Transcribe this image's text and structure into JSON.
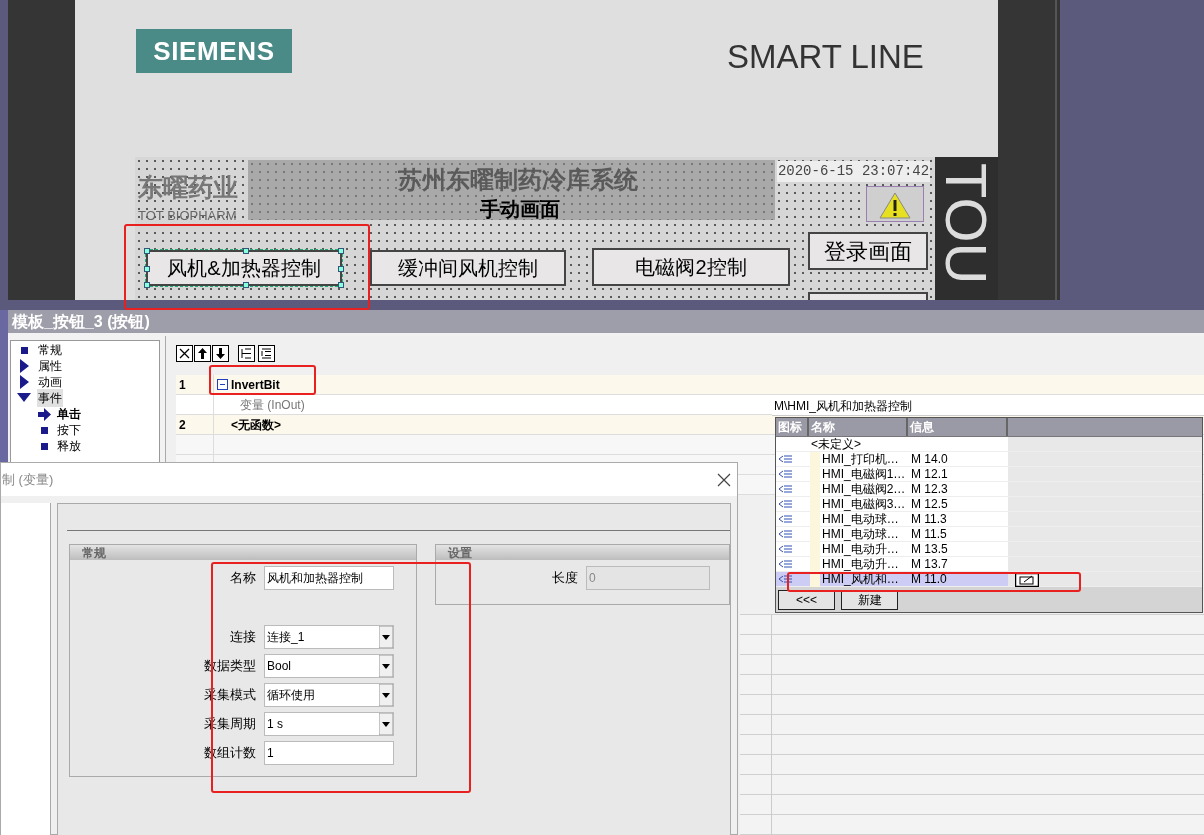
{
  "hmi_device": {
    "brand": "SIEMENS",
    "model": "SMART LINE",
    "side_label": "TOU"
  },
  "hmi_screen": {
    "logo": {
      "name": "东曜药业",
      "subtitle": "TOT BIOPHARM"
    },
    "title": "苏州东曜制药冷库系统",
    "subtitle": "手动画面",
    "datetime": "2020-6-15 23:07:42",
    "buttons": [
      {
        "label": "风机&加热器控制",
        "selected": true
      },
      {
        "label": "缓冲间风机控制",
        "selected": false
      },
      {
        "label": "电磁阀2控制",
        "selected": false
      },
      {
        "label": "登录画面",
        "selected": false
      }
    ]
  },
  "properties_panel": {
    "title": "模板_按钮_3 (按钮)",
    "tree": [
      {
        "label": "常规",
        "kind": "leaf",
        "selected": false
      },
      {
        "label": "属性",
        "kind": "branch",
        "expanded": false,
        "selected": false
      },
      {
        "label": "动画",
        "kind": "branch",
        "expanded": false,
        "selected": false
      },
      {
        "label": "事件",
        "kind": "branch",
        "expanded": true,
        "selected": true,
        "children": [
          {
            "label": "单击",
            "selected": true
          },
          {
            "label": "按下",
            "selected": false
          },
          {
            "label": "释放",
            "selected": false
          }
        ]
      }
    ],
    "functions": [
      {
        "number": "1",
        "name": "InvertBit",
        "expanded": true,
        "parameter": "变量 (InOut)"
      },
      {
        "number": "2",
        "name": "<无函数>",
        "expanded": false
      }
    ],
    "tag_field": "M\\HMI_风机和加热器控制",
    "tag_list": {
      "columns": [
        "图标",
        "名称",
        "信息"
      ],
      "rows": [
        {
          "kind": "none",
          "name": "<未定义>",
          "selected": false
        },
        {
          "kind": "tag",
          "name": "HMI_打印机…",
          "address": "M 14.0",
          "selected": false
        },
        {
          "kind": "tag",
          "name": "HMI_电磁阀1…",
          "address": "M 12.1",
          "selected": false
        },
        {
          "kind": "tag",
          "name": "HMI_电磁阀2…",
          "address": "M 12.3",
          "selected": false
        },
        {
          "kind": "tag",
          "name": "HMI_电磁阀3…",
          "address": "M 12.5",
          "selected": false
        },
        {
          "kind": "tag",
          "name": "HMI_电动球…",
          "address": "M 11.3",
          "selected": false
        },
        {
          "kind": "tag",
          "name": "HMI_电动球…",
          "address": "M 11.5",
          "selected": false
        },
        {
          "kind": "tag",
          "name": "HMI_电动升…",
          "address": "M 13.5",
          "selected": false
        },
        {
          "kind": "tag",
          "name": "HMI_电动升…",
          "address": "M 13.7",
          "selected": false
        },
        {
          "kind": "tag",
          "name": "HMI_风机和…",
          "address": "M 11.0",
          "selected": true
        }
      ],
      "buttons": [
        "<<<",
        "新建"
      ]
    }
  },
  "dialog": {
    "title": "制 (变量)",
    "general": {
      "title": "常规",
      "fields": [
        {
          "label": "名称",
          "value": "风机和加热器控制",
          "kind": "text",
          "disabled": false
        },
        {
          "label": "连接",
          "value": "连接_1",
          "kind": "dropdown",
          "disabled": false
        },
        {
          "label": "数据类型",
          "value": "Bool",
          "kind": "dropdown",
          "disabled": false
        },
        {
          "label": "采集模式",
          "value": "循环使用",
          "kind": "dropdown",
          "disabled": false
        },
        {
          "label": "采集周期",
          "value": "1 s",
          "kind": "dropdown",
          "disabled": false
        },
        {
          "label": "数组计数",
          "value": "1",
          "kind": "text",
          "disabled": false
        }
      ]
    },
    "settings": {
      "title": "设置",
      "fields": [
        {
          "label": "长度",
          "value": "0",
          "kind": "text",
          "disabled": true
        }
      ]
    }
  }
}
